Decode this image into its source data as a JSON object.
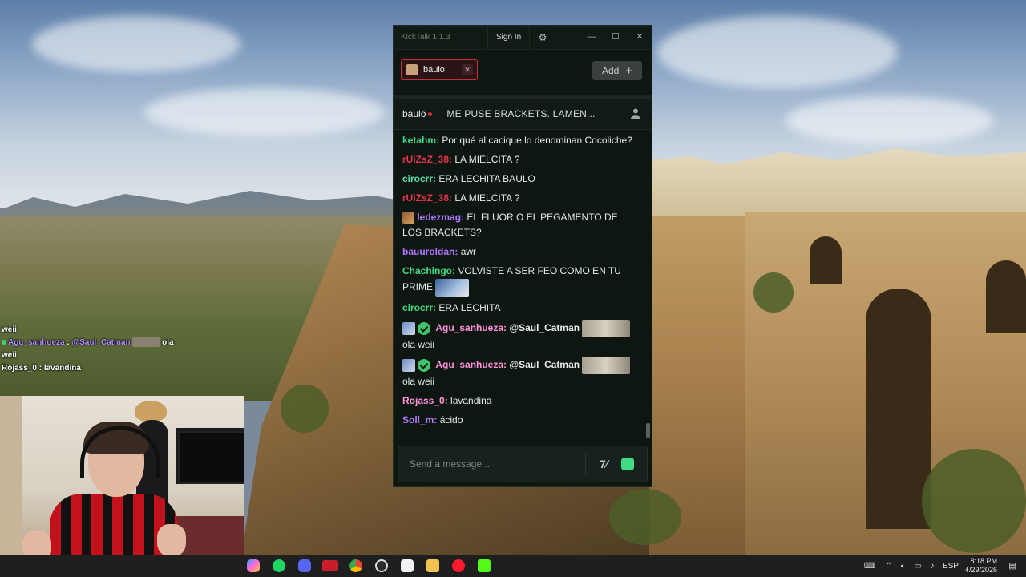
{
  "overlay_chat": {
    "lines": [
      {
        "user": "",
        "text": "weii"
      },
      {
        "user": "Agu_sanhueza",
        "mention": "@Saul_Catman",
        "text": "ola"
      },
      {
        "user": "",
        "text": "weii"
      },
      {
        "user": "Rojass_0",
        "text": "lavandina"
      }
    ]
  },
  "kicktalk": {
    "app_title": "KickTalk 1.1.3",
    "sign_in_label": "Sign In",
    "tab": {
      "label": "baulo"
    },
    "add_label": "Add",
    "stream": {
      "channel": "baulo",
      "title": "ME PUSE BRACKETS. LAMEN..."
    },
    "messages": [
      {
        "user": "ketahm",
        "text": "Por qué al cacique lo denominan Cocoliche?"
      },
      {
        "user": "rUiZsZ_38",
        "text": "LA MIELCITA ?"
      },
      {
        "user": "cirocrr",
        "text": "ERA LECHITA BAULO"
      },
      {
        "user": "rUiZsZ_38",
        "text": "LA MIELCITA ?"
      },
      {
        "user": "ledezmag",
        "text": "EL FLUOR O EL PEGAMENTO DE LOS BRACKETS?"
      },
      {
        "user": "bauuroldan",
        "text": "awr"
      },
      {
        "user": "Chachingo",
        "text": "VOLVISTE A SER FEO COMO EN TU PRIME"
      },
      {
        "user": "cirocrr",
        "text": "ERA LECHITA"
      },
      {
        "user": "Agu_sanhueza",
        "mention": "@Saul_Catman",
        "text": "ola weii"
      },
      {
        "user": "Agu_sanhueza",
        "mention": "@Saul_Catman",
        "text": "ola weii"
      },
      {
        "user": "Rojass_0",
        "text": "lavandina"
      },
      {
        "user": "Soll_m",
        "text": "ácido"
      }
    ],
    "input_placeholder": "Send a message..."
  },
  "taskbar": {
    "language": "ESP",
    "time": "8:18 PM",
    "date": "4/29/2026"
  },
  "colors": {
    "kick_green": "#3fdc84",
    "window_bg": "#0d1611",
    "tab_border": "#c2343a"
  }
}
